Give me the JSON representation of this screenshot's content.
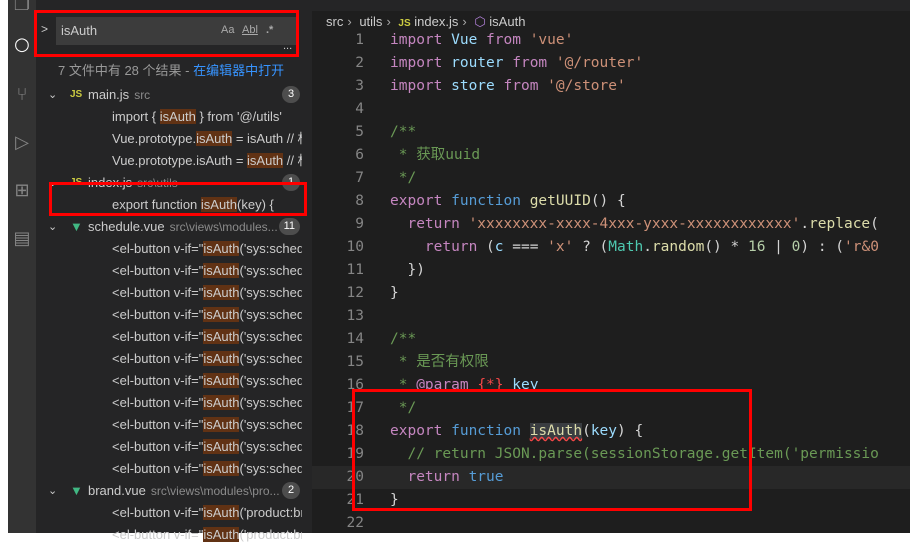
{
  "search": {
    "query": "isAuth",
    "opt_case": "Aa",
    "opt_word": "Abl",
    "opt_regex": ".*",
    "more": "...",
    "summary": "7 文件中有 28 个结果 - ",
    "open_in_editor": "在编辑器中打开"
  },
  "results": [
    {
      "type": "file",
      "name": "main.js",
      "path": "src",
      "icon": "js-icon",
      "count": "3"
    },
    {
      "type": "match",
      "pre": "import { ",
      "hit": "isAuth",
      "post": " } from '@/utils'"
    },
    {
      "type": "match",
      "pre": "Vue.prototype.",
      "hit": "isAuth",
      "post": " = isAuth     // 权..."
    },
    {
      "type": "match",
      "pre": "Vue.prototype.isAuth = ",
      "hit": "isAuth",
      "post": "     // 权..."
    },
    {
      "type": "file",
      "name": "index.js",
      "path": "src\\utils",
      "icon": "js-icon",
      "count": "1"
    },
    {
      "type": "match",
      "pre": "export function ",
      "hit": "isAuth",
      "post": "(key) {"
    },
    {
      "type": "file",
      "name": "schedule.vue",
      "path": "src\\views\\modules...",
      "icon": "vue-icon",
      "count": "11"
    },
    {
      "type": "match",
      "pre": "<el-button v-if=\"",
      "hit": "isAuth",
      "post": "('sys:schedule:sa..."
    },
    {
      "type": "match",
      "pre": "<el-button v-if=\"",
      "hit": "isAuth",
      "post": "('sys:schedule:d..."
    },
    {
      "type": "match",
      "pre": "<el-button v-if=\"",
      "hit": "isAuth",
      "post": "('sys:schedule:p..."
    },
    {
      "type": "match",
      "pre": "<el-button v-if=\"",
      "hit": "isAuth",
      "post": "('sys:schedule:re..."
    },
    {
      "type": "match",
      "pre": "<el-button v-if=\"",
      "hit": "isAuth",
      "post": "('sys:schedule:ru..."
    },
    {
      "type": "match",
      "pre": "<el-button v-if=\"",
      "hit": "isAuth",
      "post": "('sys:schedule:lo..."
    },
    {
      "type": "match",
      "pre": "<el-button v-if=\"",
      "hit": "isAuth",
      "post": "('sys:schedule:u..."
    },
    {
      "type": "match",
      "pre": "<el-button v-if=\"",
      "hit": "isAuth",
      "post": "('sys:schedule:d..."
    },
    {
      "type": "match",
      "pre": "<el-button v-if=\"",
      "hit": "isAuth",
      "post": "('sys:schedule:p..."
    },
    {
      "type": "match",
      "pre": "<el-button v-if=\"",
      "hit": "isAuth",
      "post": "('sys:schedule:re..."
    },
    {
      "type": "match",
      "pre": "<el-button v-if=\"",
      "hit": "isAuth",
      "post": "('sys:schedule:ru..."
    },
    {
      "type": "file",
      "name": "brand.vue",
      "path": "src\\views\\modules\\pro...",
      "icon": "vue-icon",
      "count": "2"
    },
    {
      "type": "match",
      "pre": "<el-button v-if=\"",
      "hit": "isAuth",
      "post": "('product:brand:..."
    },
    {
      "type": "match",
      "pre": "<el-button v-if=\"",
      "hit": "isAuth",
      "post": "('product:brand:..."
    }
  ],
  "breadcrumb": [
    "src",
    "utils",
    "index.js",
    "isAuth"
  ],
  "code": [
    {
      "n": "1",
      "t": [
        [
          "import",
          "k"
        ],
        [
          " Vue ",
          "v"
        ],
        [
          "from",
          "k"
        ],
        [
          " 'vue'",
          "s"
        ]
      ]
    },
    {
      "n": "2",
      "t": [
        [
          "import",
          "k"
        ],
        [
          " router ",
          "v"
        ],
        [
          "from",
          "k"
        ],
        [
          " '@/router'",
          "s"
        ]
      ]
    },
    {
      "n": "3",
      "t": [
        [
          "import",
          "k"
        ],
        [
          " store ",
          "v"
        ],
        [
          "from",
          "k"
        ],
        [
          " '@/store'",
          "s"
        ]
      ]
    },
    {
      "n": "4",
      "t": []
    },
    {
      "n": "5",
      "t": [
        [
          "/**",
          "c"
        ]
      ]
    },
    {
      "n": "6",
      "t": [
        [
          " * 获取uuid",
          "c"
        ]
      ]
    },
    {
      "n": "7",
      "t": [
        [
          " */",
          "c"
        ]
      ]
    },
    {
      "n": "8",
      "t": [
        [
          "export",
          "k"
        ],
        [
          " function ",
          "k2"
        ],
        [
          "getUUID",
          "f"
        ],
        [
          "() {",
          "p"
        ]
      ]
    },
    {
      "n": "9",
      "t": [
        [
          "  return ",
          "k"
        ],
        [
          "'xxxxxxxx-xxxx-4xxx-yxxx-xxxxxxxxxxxx'",
          "s"
        ],
        [
          ".",
          "p"
        ],
        [
          "replace",
          "f"
        ],
        [
          "(",
          "p"
        ]
      ]
    },
    {
      "n": "10",
      "t": [
        [
          "    return ",
          "k"
        ],
        [
          "(",
          "p"
        ],
        [
          "c",
          "v"
        ],
        [
          " === ",
          "p"
        ],
        [
          "'x'",
          "s"
        ],
        [
          " ? (",
          "p"
        ],
        [
          "Math",
          "t"
        ],
        [
          ".",
          "p"
        ],
        [
          "random",
          "f"
        ],
        [
          "() * ",
          "p"
        ],
        [
          "16",
          "n"
        ],
        [
          " | ",
          "p"
        ],
        [
          "0",
          "n"
        ],
        [
          ") : (",
          "p"
        ],
        [
          "'r&0",
          "s"
        ]
      ]
    },
    {
      "n": "11",
      "t": [
        [
          "  })",
          "p"
        ]
      ]
    },
    {
      "n": "12",
      "t": [
        [
          "}",
          "p"
        ]
      ]
    },
    {
      "n": "13",
      "t": []
    },
    {
      "n": "14",
      "t": [
        [
          "/**",
          "c"
        ]
      ]
    },
    {
      "n": "15",
      "t": [
        [
          " * 是否有权限",
          "c"
        ]
      ]
    },
    {
      "n": "16",
      "t": [
        [
          " * ",
          "c"
        ],
        [
          "@param",
          "k"
        ],
        [
          " {*}",
          "r"
        ],
        [
          " key",
          "v"
        ]
      ]
    },
    {
      "n": "17",
      "t": [
        [
          " */",
          "c"
        ]
      ]
    },
    {
      "n": "18",
      "t": [
        [
          "export",
          "k"
        ],
        [
          " function ",
          "k2"
        ],
        [
          "isAuth",
          "f sel"
        ],
        [
          "(",
          "p"
        ],
        [
          "key",
          "v"
        ],
        [
          ") {",
          "p"
        ]
      ]
    },
    {
      "n": "19",
      "t": [
        [
          "  // return JSON.parse(sessionStorage.getItem('permissio",
          "c"
        ]
      ]
    },
    {
      "n": "20",
      "t": [
        [
          "  return ",
          "k"
        ],
        [
          "true",
          "k2"
        ]
      ]
    },
    {
      "n": "21",
      "t": [
        [
          "}",
          "p"
        ]
      ]
    },
    {
      "n": "22",
      "t": []
    },
    {
      "n": "23",
      "t": [
        [
          "/**",
          "c"
        ]
      ]
    }
  ],
  "current_line": "20",
  "colors": {
    "match_highlight": "#613214",
    "annotation_box": "#ff0000",
    "accent_link": "#3794ff"
  }
}
